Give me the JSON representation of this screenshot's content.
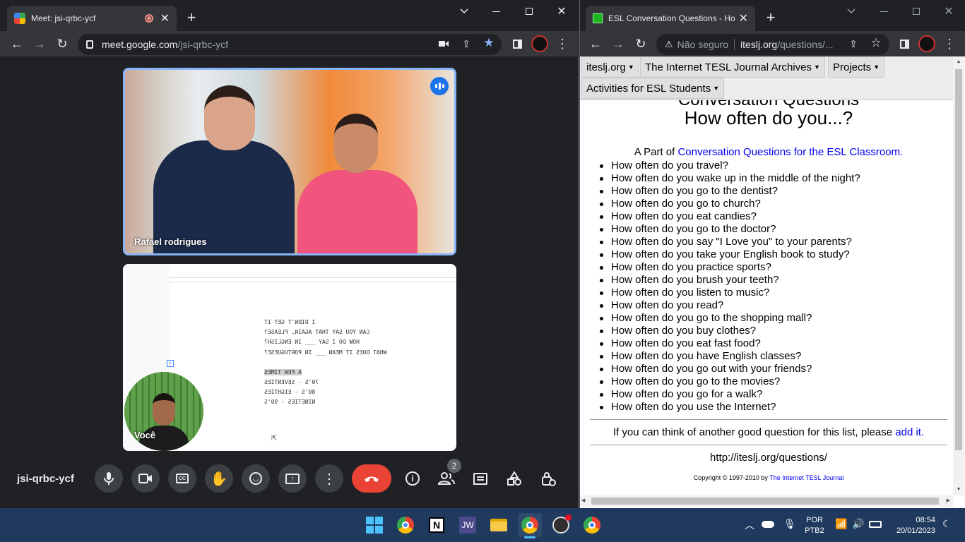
{
  "left_window": {
    "tab_title": "Meet: jsi-qrbc-ycf",
    "url_host": "meet.google.com",
    "url_path": "/jsi-qrbc-ycf",
    "participant_name": "Rafael rodrigues",
    "self_label": "Você",
    "meeting_code": "jsi-qrbc-ycf",
    "participants_badge": "2",
    "shared_doc_lines": [
      "I DIDN'T GET IT",
      "CAN YOU SAY THAT AGAIN, PLEASE?",
      "HOW DO I SAY ___ IN ENGLISH?",
      "WHAT DOES IT MEAN ___ IN PORTUGUESE?",
      "",
      "A FEW TIMES",
      "70'S - SEVENTIES",
      "80'S - EIGHTIES",
      "NINETIES - 90'S"
    ],
    "controls": [
      "mic-icon",
      "camera-icon",
      "captions-icon",
      "raise-hand-icon",
      "emoji-icon",
      "present-icon",
      "more-icon",
      "end-call-icon",
      "info-icon",
      "people-icon",
      "chat-icon",
      "activities-icon",
      "host-controls-icon"
    ]
  },
  "right_window": {
    "tab_title": "ESL Conversation Questions - Ho",
    "security_label": "Não seguro",
    "url_host": "iteslj.org",
    "url_path": "/questions/...",
    "nav": {
      "item1": "iteslj.org",
      "item2": "The Internet TESL Journal Archives",
      "item3": "Projects",
      "item4": "Activities for ESL Students"
    },
    "heading_top": "Conversation Questions",
    "heading": "How often do you...?",
    "part_of_prefix": "A Part of ",
    "part_of_link": "Conversation Questions for the ESL Classroom.",
    "questions": [
      "How often do you travel?",
      "How often do you wake up in the middle of the night?",
      "How often do you go to the dentist?",
      "How often do you go to church?",
      "How often do you eat candies?",
      "How often do you go to the doctor?",
      "How often do you say \"I Love you\" to your parents?",
      "How often do you take your English book to study?",
      "How often do you practice sports?",
      "How often do you brush your teeth?",
      "How often do you listen to music?",
      "How often do you read?",
      "How often do you go to the shopping mall?",
      "How often do you buy clothes?",
      "How often do you eat fast food?",
      "How often do you have English classes?",
      "How often do you go out with your friends?",
      "How often do you go to the movies?",
      "How often do you go for a walk?",
      "How often do you use the Internet?"
    ],
    "footer_prefix": "If you can think of another good question for this list, please ",
    "footer_link": "add it.",
    "site_url": "http://iteslj.org/questions/",
    "copyright_prefix": "Copyright © 1997-2010 by ",
    "copyright_link": "The Internet TESL Journal"
  },
  "taskbar": {
    "lang": "POR",
    "layout": "PTB2",
    "time": "08:54",
    "date": "20/01/2023",
    "apps": [
      "windows-start-icon",
      "chrome-icon",
      "notion-icon",
      "jw-icon",
      "file-explorer-icon",
      "chrome-active-icon",
      "obs-icon",
      "chrome-profile-icon"
    ]
  },
  "colors": {
    "meet_accent": "#8ab4f8",
    "end_call": "#ea4335",
    "link": "#0000ee",
    "taskbar": "#1f3a5e"
  }
}
